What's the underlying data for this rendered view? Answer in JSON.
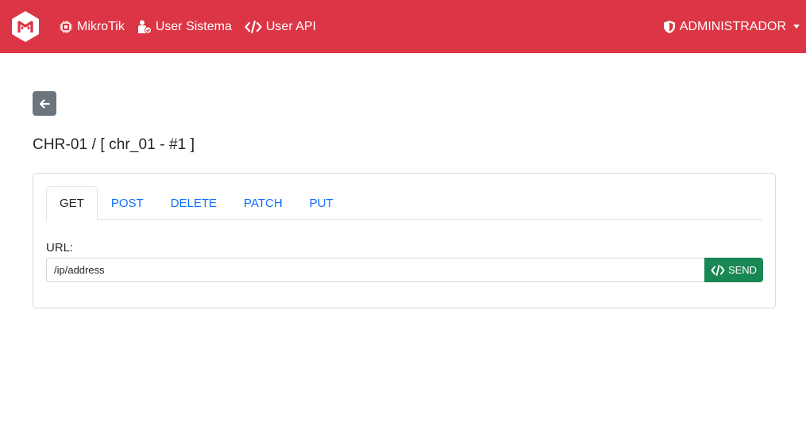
{
  "navbar": {
    "brand_icon": "mikrotik-logo",
    "links": [
      {
        "label": "MikroTik",
        "icon": "chip-icon"
      },
      {
        "label": "User Sistema",
        "icon": "user-check-icon"
      },
      {
        "label": "User API",
        "icon": "code-icon"
      }
    ],
    "user_menu": {
      "label": "ADMINISTRADOR",
      "icon": "shield-icon"
    }
  },
  "back_button": {
    "icon": "arrow-left-icon"
  },
  "page_title": "CHR-01 / [ chr_01 - #1 ]",
  "tabs": [
    {
      "label": "GET",
      "active": true
    },
    {
      "label": "POST",
      "active": false
    },
    {
      "label": "DELETE",
      "active": false
    },
    {
      "label": "PATCH",
      "active": false
    },
    {
      "label": "PUT",
      "active": false
    }
  ],
  "form": {
    "url_label": "URL:",
    "url_value": "/ip/address",
    "send_label": "SEND"
  },
  "colors": {
    "navbar": "#dc3545",
    "tab_link": "#0d6efd",
    "send_button": "#198754",
    "back_button": "#6c757d"
  }
}
